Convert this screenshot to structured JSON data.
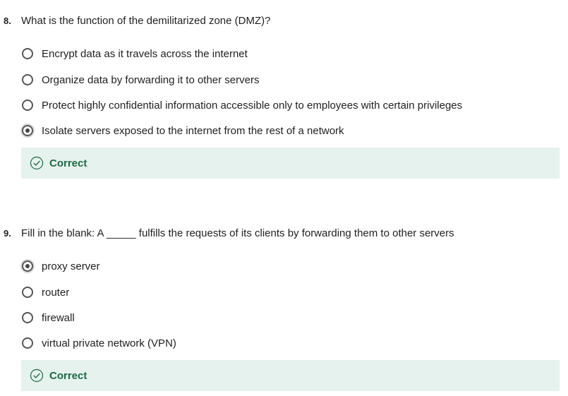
{
  "questions": [
    {
      "number": "8.",
      "text": "What is the function of the demilitarized zone (DMZ)?",
      "options": [
        {
          "label": "Encrypt data as it travels across the internet",
          "selected": false
        },
        {
          "label": "Organize data by forwarding it to other servers",
          "selected": false
        },
        {
          "label": "Protect highly confidential information accessible only to employees with certain privileges",
          "selected": false
        },
        {
          "label": "Isolate servers exposed to the internet from the rest of a network",
          "selected": true
        }
      ],
      "feedback": "Correct"
    },
    {
      "number": "9.",
      "text": "Fill in the blank: A _____ fulfills the requests of its clients by forwarding them to other servers",
      "options": [
        {
          "label": "proxy server",
          "selected": true
        },
        {
          "label": "router",
          "selected": false
        },
        {
          "label": "firewall",
          "selected": false
        },
        {
          "label": "virtual private network (VPN)",
          "selected": false
        }
      ],
      "feedback": "Correct"
    }
  ],
  "colors": {
    "feedback_bg": "#e6f2ee",
    "feedback_text": "#1b6b43"
  },
  "icons": {
    "feedback": "check-circle-icon",
    "radio": "radio-button-icon"
  }
}
